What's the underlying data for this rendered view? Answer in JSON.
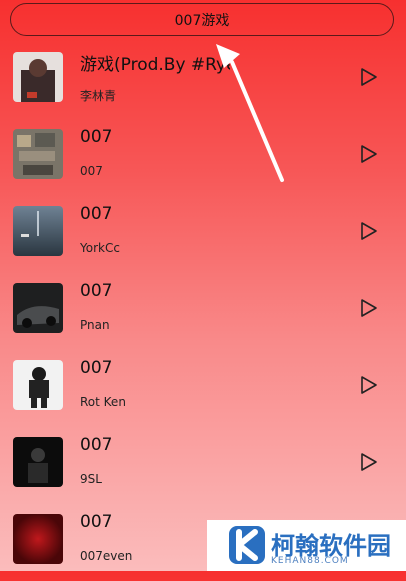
{
  "search": {
    "value": "007游戏"
  },
  "songs": [
    {
      "title": "游戏(Prod.By #Rye",
      "artist": "李林青",
      "cover_color": "#3a2a2a"
    },
    {
      "title": "007",
      "artist": "007",
      "cover_color": "#6a6a5a"
    },
    {
      "title": "007",
      "artist": "YorkCc",
      "cover_color": "#3f4f5f"
    },
    {
      "title": "007",
      "artist": "Pnan",
      "cover_color": "#2a2a2a"
    },
    {
      "title": "007",
      "artist": "Rot Ken",
      "cover_color": "#e8e8e8"
    },
    {
      "title": "007",
      "artist": "9SL",
      "cover_color": "#111111"
    },
    {
      "title": "007",
      "artist": "007even",
      "cover_color": "#8a0f12"
    }
  ],
  "watermark": {
    "title": "柯翰软件园",
    "subtitle": "KEHAN88.COM"
  },
  "colors": {
    "accent": "#f7302f",
    "watermark_blue": "#2a6fc0"
  }
}
